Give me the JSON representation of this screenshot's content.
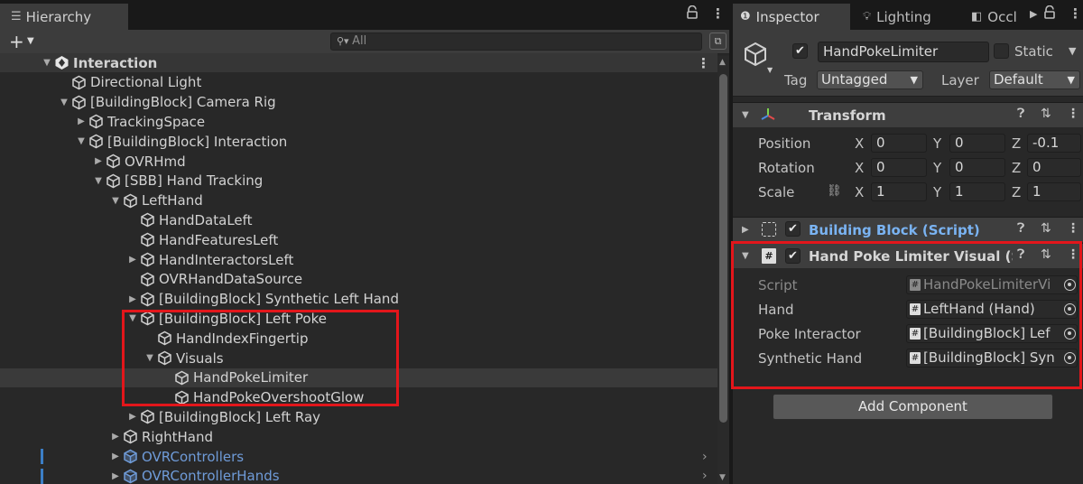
{
  "hierarchy": {
    "tab_label": "Hierarchy",
    "search_placeholder": "All",
    "rows": [
      {
        "label": "Interaction",
        "indent": 0,
        "arrow": "down",
        "icon": "unity-scene-icon",
        "type": "scene"
      },
      {
        "label": "Directional Light",
        "indent": 1,
        "arrow": "none",
        "icon": "gameobject-cube-icon"
      },
      {
        "label": "[BuildingBlock] Camera Rig",
        "indent": 1,
        "arrow": "down",
        "icon": "gameobject-cube-icon"
      },
      {
        "label": "TrackingSpace",
        "indent": 2,
        "arrow": "right",
        "icon": "gameobject-cube-icon"
      },
      {
        "label": "[BuildingBlock] Interaction",
        "indent": 2,
        "arrow": "down",
        "icon": "gameobject-cube-icon"
      },
      {
        "label": "OVRHmd",
        "indent": 3,
        "arrow": "right",
        "icon": "gameobject-cube-icon"
      },
      {
        "label": "[SBB] Hand Tracking",
        "indent": 3,
        "arrow": "down",
        "icon": "gameobject-cube-icon"
      },
      {
        "label": "LeftHand",
        "indent": 4,
        "arrow": "down",
        "icon": "gameobject-cube-icon"
      },
      {
        "label": "HandDataLeft",
        "indent": 5,
        "arrow": "none",
        "icon": "gameobject-cube-icon"
      },
      {
        "label": "HandFeaturesLeft",
        "indent": 5,
        "arrow": "none",
        "icon": "gameobject-cube-icon"
      },
      {
        "label": "HandInteractorsLeft",
        "indent": 5,
        "arrow": "right",
        "icon": "gameobject-cube-icon"
      },
      {
        "label": "OVRHandDataSource",
        "indent": 5,
        "arrow": "none",
        "icon": "gameobject-cube-icon"
      },
      {
        "label": "[BuildingBlock] Synthetic Left Hand",
        "indent": 5,
        "arrow": "right",
        "icon": "gameobject-cube-icon"
      },
      {
        "label": "[BuildingBlock] Left Poke",
        "indent": 5,
        "arrow": "down",
        "icon": "gameobject-cube-icon"
      },
      {
        "label": "HandIndexFingertip",
        "indent": 6,
        "arrow": "none",
        "icon": "gameobject-cube-icon"
      },
      {
        "label": "Visuals",
        "indent": 6,
        "arrow": "down",
        "icon": "gameobject-cube-icon"
      },
      {
        "label": "HandPokeLimiter",
        "indent": 7,
        "arrow": "none",
        "icon": "gameobject-cube-icon",
        "selected": true
      },
      {
        "label": "HandPokeOvershootGlow",
        "indent": 7,
        "arrow": "none",
        "icon": "gameobject-cube-icon"
      },
      {
        "label": "[BuildingBlock] Left Ray",
        "indent": 5,
        "arrow": "right",
        "icon": "gameobject-cube-icon"
      },
      {
        "label": "RightHand",
        "indent": 4,
        "arrow": "right",
        "icon": "gameobject-cube-icon"
      },
      {
        "label": "OVRControllers",
        "indent": 4,
        "arrow": "right",
        "icon": "prefab-cube-icon",
        "type": "prefab"
      },
      {
        "label": "OVRControllerHands",
        "indent": 4,
        "arrow": "right",
        "icon": "prefab-cube-icon",
        "type": "prefab"
      }
    ]
  },
  "inspector": {
    "tabs": [
      "Inspector",
      "Lighting",
      "Occl"
    ],
    "object_name": "HandPokeLimiter",
    "static_label": "Static",
    "tag_label": "Tag",
    "tag_value": "Untagged",
    "layer_label": "Layer",
    "layer_value": "Default",
    "transform": {
      "title": "Transform",
      "position_label": "Position",
      "rotation_label": "Rotation",
      "scale_label": "Scale",
      "x": "X",
      "y": "Y",
      "z": "Z",
      "position": [
        "0",
        "0",
        "-0.1"
      ],
      "rotation": [
        "0",
        "0",
        "0"
      ],
      "scale": [
        "1",
        "1",
        "1"
      ]
    },
    "building_block": {
      "title": "Building Block (Script)"
    },
    "poke_visual": {
      "title": "Hand Poke Limiter Visual (S",
      "fields": [
        {
          "label": "Script",
          "value": "HandPokeLimiterVi",
          "dim": true
        },
        {
          "label": "Hand",
          "value": "LeftHand (Hand)"
        },
        {
          "label": "Poke Interactor",
          "value": "[BuildingBlock] Lef"
        },
        {
          "label": "Synthetic Hand",
          "value": "[BuildingBlock] Syn"
        }
      ]
    },
    "add_component_label": "Add Component"
  },
  "colors": {
    "highlight": "#e3161b",
    "prefab_blue": "#6f9bd8",
    "script_link_blue": "#7ab3f2"
  }
}
